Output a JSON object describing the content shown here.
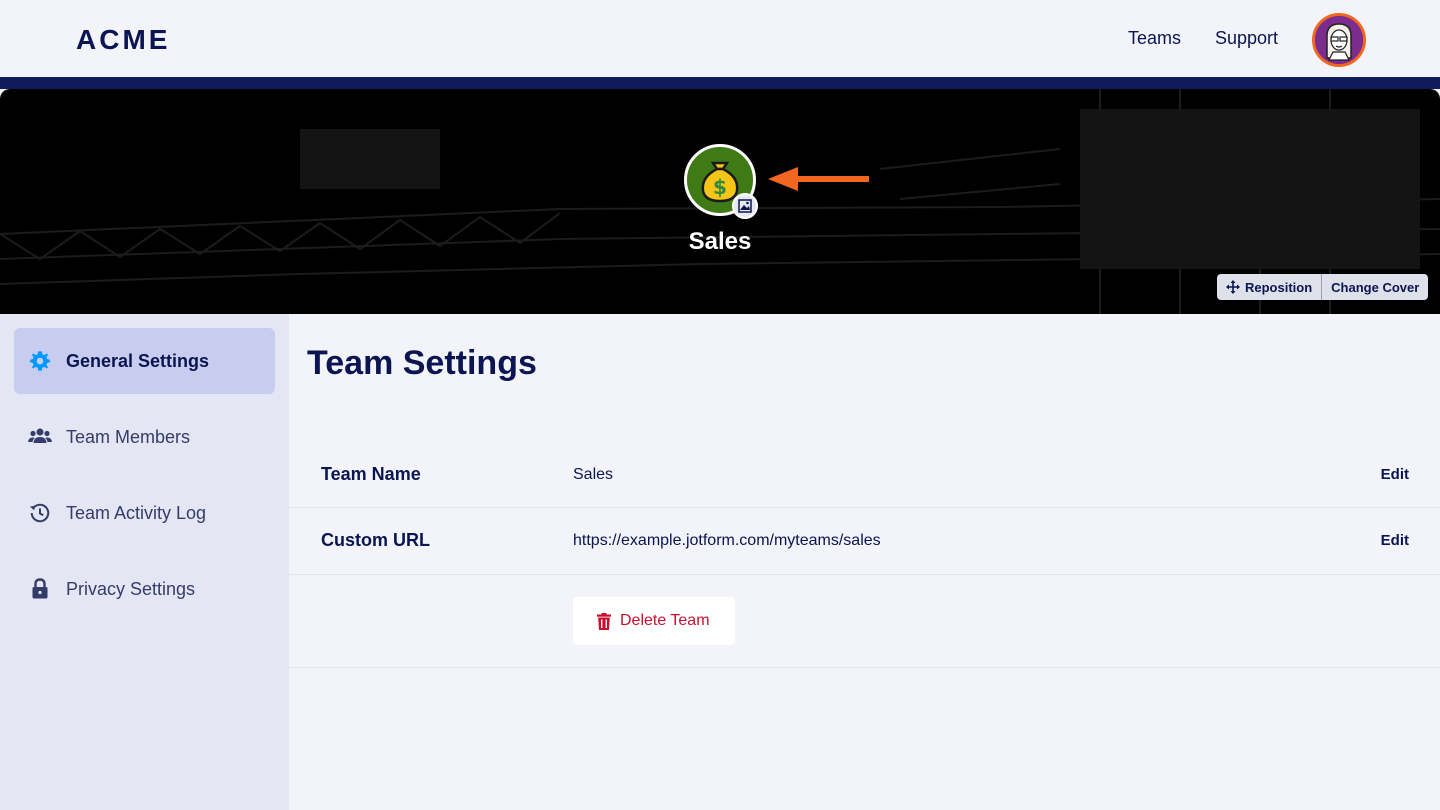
{
  "header": {
    "logo": "ACME",
    "nav": {
      "teams": "Teams",
      "support": "Support"
    }
  },
  "cover": {
    "team_name": "Sales",
    "avatar_icon": "money-bag-icon",
    "reposition_label": "Reposition",
    "change_cover_label": "Change Cover"
  },
  "sidebar": {
    "items": [
      {
        "label": "General Settings",
        "icon": "gear-icon",
        "active": true
      },
      {
        "label": "Team Members",
        "icon": "users-icon",
        "active": false
      },
      {
        "label": "Team Activity Log",
        "icon": "history-icon",
        "active": false
      },
      {
        "label": "Privacy Settings",
        "icon": "lock-icon",
        "active": false
      }
    ]
  },
  "main": {
    "title": "Team Settings",
    "rows": [
      {
        "label": "Team Name",
        "value": "Sales",
        "action": "Edit"
      },
      {
        "label": "Custom URL",
        "value": "https://example.jotform.com/myteams/sales",
        "action": "Edit"
      }
    ],
    "delete_label": "Delete Team"
  },
  "colors": {
    "accent_orange": "#f2661f",
    "navy": "#0a1551",
    "danger": "#c8102e",
    "active_bg": "#c8cdf0",
    "sidebar_bg": "#e4e6f4"
  }
}
